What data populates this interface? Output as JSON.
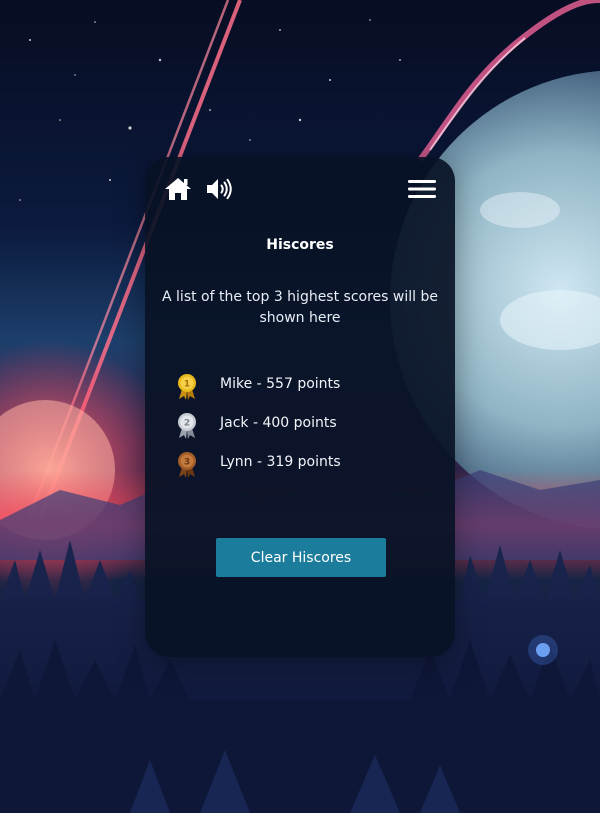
{
  "header": {
    "home_icon": "home-icon",
    "sound_icon": "speaker-volume-icon",
    "menu_icon": "hamburger-menu-icon"
  },
  "title": "Hiscores",
  "subtitle": "A list of the top 3 highest scores will be shown here",
  "scores": [
    {
      "rank": 1,
      "medal": "gold-medal-icon",
      "text": "Mike - 557 points"
    },
    {
      "rank": 2,
      "medal": "silver-medal-icon",
      "text": "Jack - 400 points"
    },
    {
      "rank": 3,
      "medal": "bronze-medal-icon",
      "text": "Lynn - 319 points"
    }
  ],
  "clear_button": {
    "label": "Clear Hiscores"
  },
  "colors": {
    "card_background": "#091226",
    "button": "#1b7c9c",
    "gold": "#e8b91d",
    "silver": "#c7ccd4",
    "bronze": "#a25c28"
  }
}
